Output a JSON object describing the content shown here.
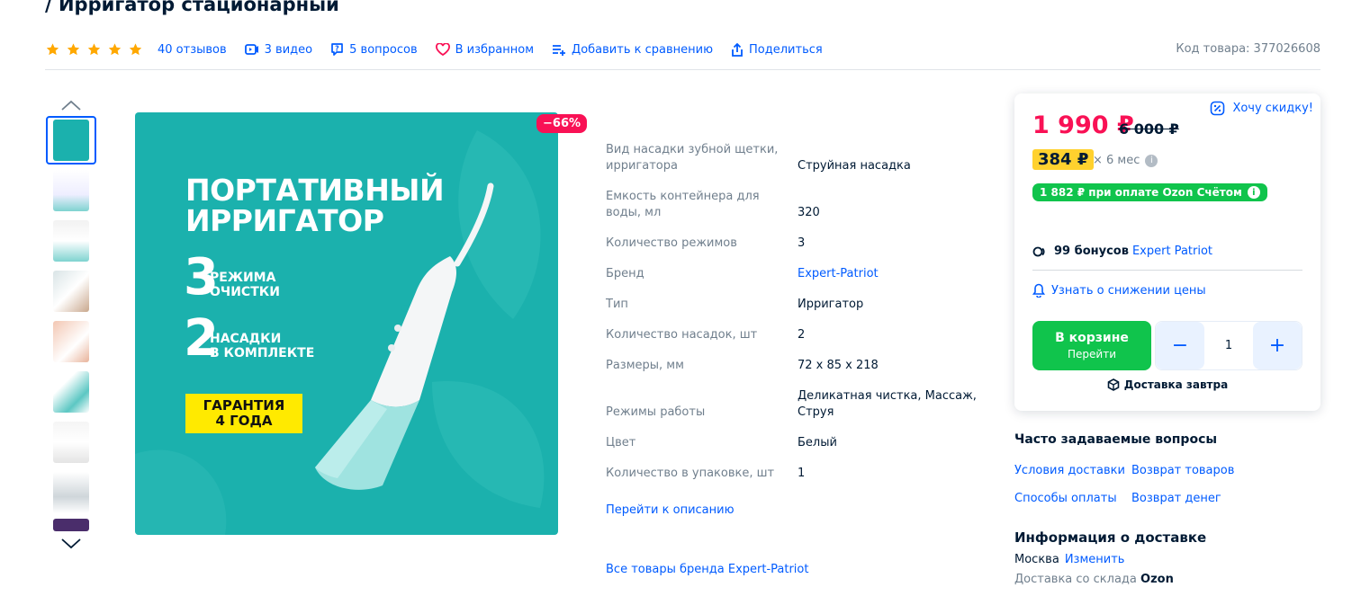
{
  "product": {
    "title": "/ Ирригатор стационарный",
    "reviews": "40 отзывов",
    "videos": "3 видео",
    "questions": "5 вопросов",
    "favorite": "В избранном",
    "compare": "Добавить к сравнению",
    "share": "Поделиться",
    "sku": "Код товара: 377026608",
    "rating_stars": 5
  },
  "image": {
    "discount": "−66%",
    "headline_1": "ПОРТАТИВНЫЙ",
    "headline_2": "ИРРИГАТОР",
    "num1": "3",
    "num1_text_1": "РЕЖИМА",
    "num1_text_2": "ОЧИСТКИ",
    "num2": "2",
    "num2_text_1": "НАСАДКИ",
    "num2_text_2": "В КОМПЛЕКТЕ",
    "badge_1": "ГАРАНТИЯ",
    "badge_2": "4 ГОДА",
    "background": "#1bb1ad"
  },
  "specs": [
    {
      "label": "Вид насадки зубной щетки, ирригатора",
      "value": "Струйная насадка"
    },
    {
      "label": "Емкость контейнера для воды, мл",
      "value": "320"
    },
    {
      "label": "Количество режимов",
      "value": "3"
    },
    {
      "label": "Бренд",
      "value": "Expert-Patriot"
    },
    {
      "label": "Тип",
      "value": "Ирригатор"
    },
    {
      "label": "Количество насадок, шт",
      "value": "2"
    },
    {
      "label": "Размеры, мм",
      "value": "72 x 85 x 218"
    },
    {
      "label": "Режимы работы",
      "value": "Деликатная чистка, Массаж, Струя"
    },
    {
      "label": "Цвет",
      "value": "Белый"
    },
    {
      "label": "Количество в упаковке, шт",
      "value": "1"
    }
  ],
  "links": {
    "go_to_description": "Перейти к описанию",
    "all_brand_products": "Все товары бренда Expert-Patriot"
  },
  "buy": {
    "want_discount": "Хочу скидку!",
    "price": "1 990 ₽",
    "old_price": "6 000 ₽",
    "installment": "384 ₽",
    "installment_term": "× 6 мес",
    "ozon_pay": "1 882 ₽ при оплате Ozon Счётом",
    "bonus_count": "99 бонусов",
    "bonus_brand": "Expert Patriot",
    "notify": "Узнать о снижении цены",
    "in_cart": "В корзине",
    "go": "Перейти",
    "qty": "1",
    "minus": "−",
    "plus": "+",
    "delivery": "Доставка завтра"
  },
  "faq": {
    "title": "Часто задаваемые вопросы",
    "links": [
      "Условия доставки",
      "Возврат товаров",
      "Способы оплаты",
      "Возврат денег"
    ]
  },
  "delivery": {
    "title": "Информация о доставке",
    "city": "Москва",
    "change": "Изменить",
    "warehouse_prefix": "Доставка со склада",
    "warehouse": "Ozon"
  },
  "colors": {
    "accent": "#005bff",
    "price": "#f91155",
    "green": "#10c44c",
    "star": "#ffa800"
  }
}
